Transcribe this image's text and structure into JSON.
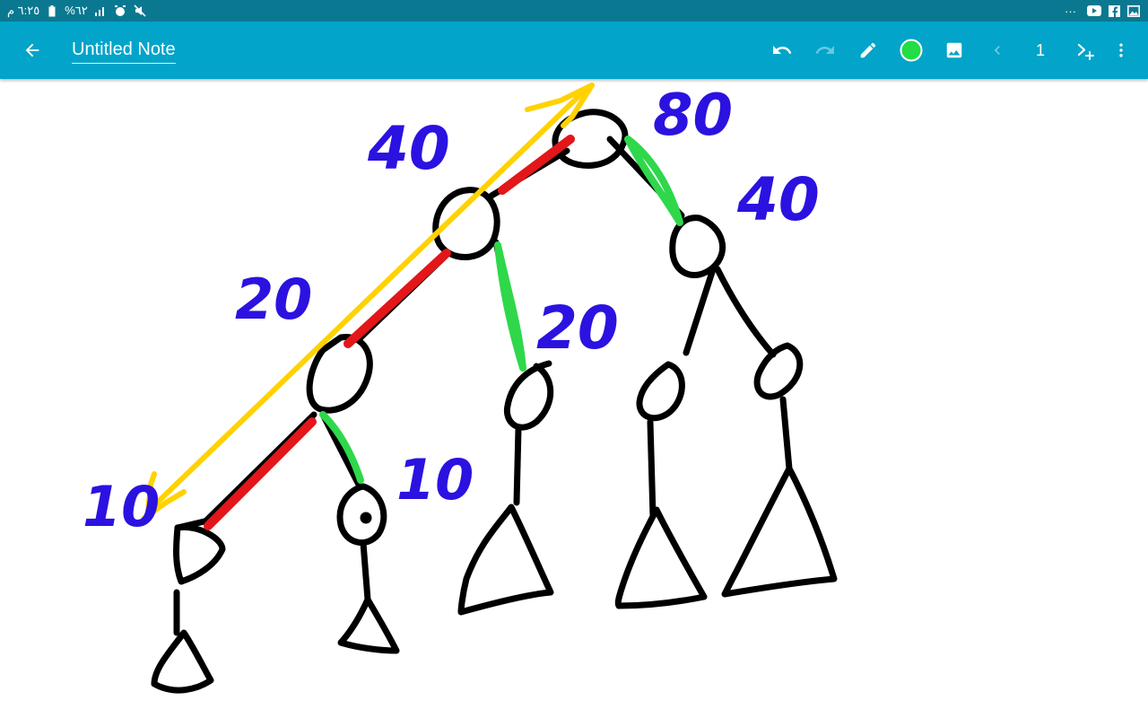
{
  "status_bar": {
    "time": "٦:٢٥ م",
    "battery": "%٦٢",
    "overflow": "···"
  },
  "toolbar": {
    "title": "Untitled Note",
    "page_number": "1",
    "pen_color": "#22dd44"
  },
  "icons": {
    "back": "arrow-left-icon",
    "undo": "undo-icon",
    "redo": "redo-icon",
    "pen": "pencil-icon",
    "color": "color-swatch-icon",
    "image": "image-icon",
    "prev": "chevron-left-icon",
    "add_page": "add-page-icon",
    "menu": "more-vert-icon"
  },
  "drawing": {
    "labels": {
      "root_right": "80",
      "root_left": "40",
      "right_child": "40",
      "left_left": "20",
      "left_right": "20",
      "ll_left": "10",
      "ll_right": "10"
    },
    "colors": {
      "ink": "#000000",
      "labels": "#2b12e0",
      "path_red": "#e3161a",
      "edge_green": "#2ed84a",
      "arrow_yellow": "#ffd200"
    }
  }
}
